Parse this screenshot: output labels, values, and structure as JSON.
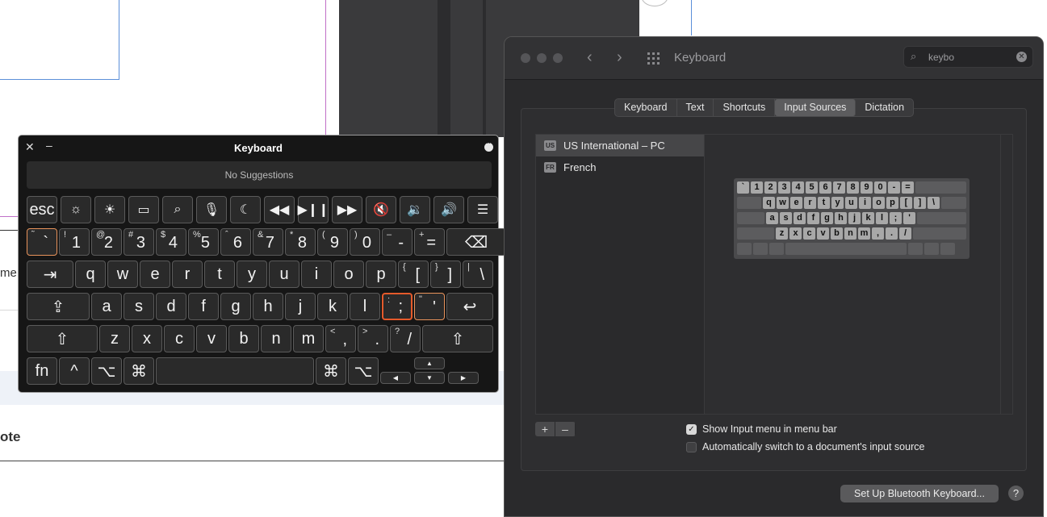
{
  "background": {
    "fragment": "me b",
    "note": "ote"
  },
  "keyboard_viewer": {
    "title": "Keyboard",
    "suggestions": "No Suggestions",
    "fn_row": [
      {
        "label": "esc",
        "icon": "escape-key"
      },
      {
        "label": "☼",
        "icon": "brightness-down-icon"
      },
      {
        "label": "☀",
        "icon": "brightness-up-icon"
      },
      {
        "label": "▭",
        "icon": "mission-control-icon"
      },
      {
        "label": "⌕",
        "icon": "spotlight-icon"
      },
      {
        "label": "🎙",
        "icon": "dictation-icon"
      },
      {
        "label": "☾",
        "icon": "do-not-disturb-icon"
      },
      {
        "label": "◀◀",
        "icon": "rewind-icon"
      },
      {
        "label": "▶❙❙",
        "icon": "play-pause-icon"
      },
      {
        "label": "▶▶",
        "icon": "fast-forward-icon"
      },
      {
        "label": "🔇",
        "icon": "mute-icon"
      },
      {
        "label": "🔉",
        "icon": "volume-down-icon"
      },
      {
        "label": "🔊",
        "icon": "volume-up-icon"
      },
      {
        "label": "☰",
        "icon": "menu-icon"
      }
    ],
    "number_row": [
      {
        "shift": "˜",
        "main": "`"
      },
      {
        "shift": "!",
        "main": "1"
      },
      {
        "shift": "@",
        "main": "2"
      },
      {
        "shift": "#",
        "main": "3"
      },
      {
        "shift": "$",
        "main": "4"
      },
      {
        "shift": "%",
        "main": "5"
      },
      {
        "shift": "ˆ",
        "main": "6"
      },
      {
        "shift": "&",
        "main": "7"
      },
      {
        "shift": "*",
        "main": "8"
      },
      {
        "shift": "(",
        "main": "9"
      },
      {
        "shift": ")",
        "main": "0"
      },
      {
        "shift": "–",
        "main": "-"
      },
      {
        "shift": "+",
        "main": "="
      },
      {
        "shift": "",
        "main": "⌫"
      }
    ],
    "q_row": [
      {
        "shift": "",
        "main": "⇥"
      },
      {
        "shift": "",
        "main": "q"
      },
      {
        "shift": "",
        "main": "w"
      },
      {
        "shift": "",
        "main": "e"
      },
      {
        "shift": "",
        "main": "r"
      },
      {
        "shift": "",
        "main": "t"
      },
      {
        "shift": "",
        "main": "y"
      },
      {
        "shift": "",
        "main": "u"
      },
      {
        "shift": "",
        "main": "i"
      },
      {
        "shift": "",
        "main": "o"
      },
      {
        "shift": "",
        "main": "p"
      },
      {
        "shift": "{",
        "main": "["
      },
      {
        "shift": "}",
        "main": "]"
      },
      {
        "shift": "|",
        "main": "\\"
      }
    ],
    "a_row": [
      {
        "shift": "",
        "main": "⇪"
      },
      {
        "shift": "",
        "main": "a"
      },
      {
        "shift": "",
        "main": "s"
      },
      {
        "shift": "",
        "main": "d"
      },
      {
        "shift": "",
        "main": "f"
      },
      {
        "shift": "",
        "main": "g"
      },
      {
        "shift": "",
        "main": "h"
      },
      {
        "shift": "",
        "main": "j"
      },
      {
        "shift": "",
        "main": "k"
      },
      {
        "shift": "",
        "main": "l"
      },
      {
        "shift": ":",
        "main": ";"
      },
      {
        "shift": "\"",
        "main": "'"
      },
      {
        "shift": "",
        "main": "↩"
      }
    ],
    "z_row": [
      {
        "shift": "",
        "main": "⇧"
      },
      {
        "shift": "",
        "main": "z"
      },
      {
        "shift": "",
        "main": "x"
      },
      {
        "shift": "",
        "main": "c"
      },
      {
        "shift": "",
        "main": "v"
      },
      {
        "shift": "",
        "main": "b"
      },
      {
        "shift": "",
        "main": "n"
      },
      {
        "shift": "",
        "main": "m"
      },
      {
        "shift": "<",
        "main": ","
      },
      {
        "shift": ">",
        "main": "."
      },
      {
        "shift": "?",
        "main": "/"
      },
      {
        "shift": "",
        "main": "⇧"
      }
    ],
    "bottom_row": [
      {
        "main": "fn"
      },
      {
        "main": "^"
      },
      {
        "main": "⌥"
      },
      {
        "main": "⌘"
      },
      {
        "main": ""
      },
      {
        "main": "⌘"
      },
      {
        "main": "⌥"
      }
    ],
    "arrows": {
      "up": "▲",
      "left": "◀",
      "down": "▼",
      "right": "▶"
    }
  },
  "prefs": {
    "title": "Keyboard",
    "search_value": "keybo",
    "tabs": [
      "Keyboard",
      "Text",
      "Shortcuts",
      "Input Sources",
      "Dictation"
    ],
    "active_tab": "Input Sources",
    "sources": [
      {
        "code": "US",
        "name": "US International – PC",
        "selected": true
      },
      {
        "code": "FR",
        "name": "French",
        "selected": false
      }
    ],
    "mini_keyboard": {
      "row1": [
        "`",
        "1",
        "2",
        "3",
        "4",
        "5",
        "6",
        "7",
        "8",
        "9",
        "0",
        "-",
        "="
      ],
      "row2": [
        "q",
        "w",
        "e",
        "r",
        "t",
        "y",
        "u",
        "i",
        "o",
        "p",
        "[",
        "]",
        "\\"
      ],
      "row3": [
        "a",
        "s",
        "d",
        "f",
        "g",
        "h",
        "j",
        "k",
        "l",
        ";",
        "'"
      ],
      "row4": [
        "z",
        "x",
        "c",
        "v",
        "b",
        "n",
        "m",
        ",",
        ".",
        "/"
      ]
    },
    "add": "+",
    "remove": "–",
    "show_menu_label": "Show Input menu in menu bar",
    "show_menu_checked": true,
    "auto_switch_label": "Automatically switch to a document's input source",
    "auto_switch_checked": false,
    "bluetooth_button": "Set Up Bluetooth Keyboard...",
    "help": "?"
  }
}
